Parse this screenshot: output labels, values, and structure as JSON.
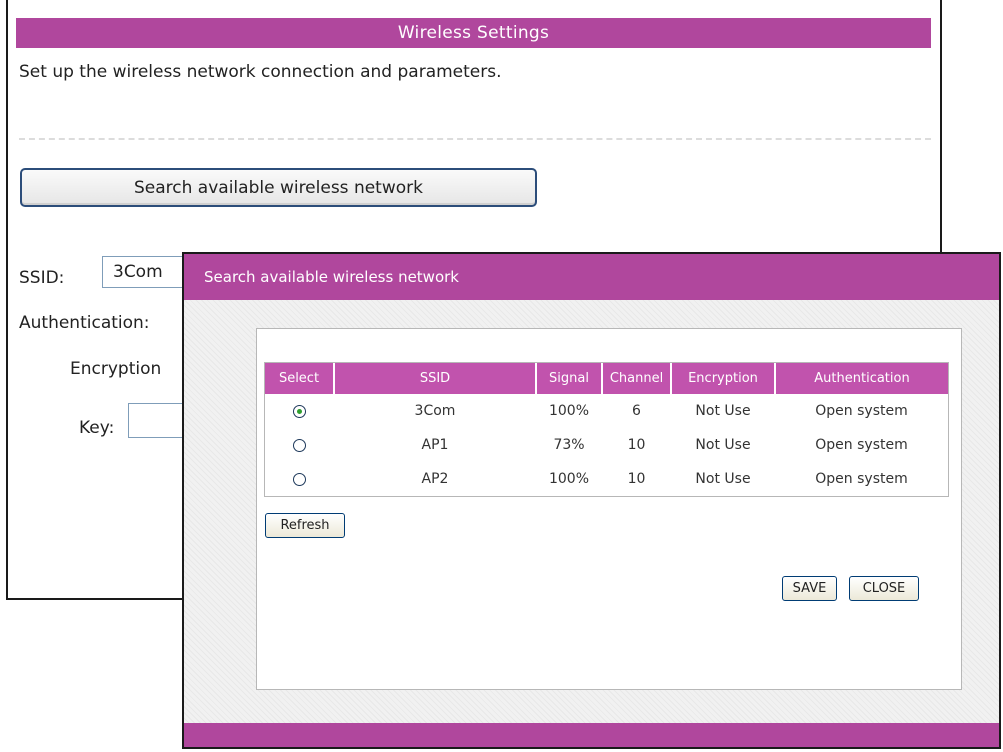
{
  "settings": {
    "header": "Wireless Settings",
    "description": "Set up the wireless network connection and parameters.",
    "search_button": "Search available wireless network",
    "ssid_label": "SSID:",
    "ssid_value": "3Com",
    "authentication_label": "Authentication:",
    "encryption_label": "Encryption",
    "key_label": "Key:"
  },
  "dialog": {
    "title": "Search available wireless network",
    "columns": [
      "Select",
      "SSID",
      "Signal",
      "Channel",
      "Encryption",
      "Authentication"
    ],
    "rows": [
      {
        "selected": true,
        "ssid": "3Com",
        "signal": "100%",
        "channel": "6",
        "encryption": "Not Use",
        "authentication": "Open system"
      },
      {
        "selected": false,
        "ssid": "AP1",
        "signal": "73%",
        "channel": "10",
        "encryption": "Not Use",
        "authentication": "Open system"
      },
      {
        "selected": false,
        "ssid": "AP2",
        "signal": "100%",
        "channel": "10",
        "encryption": "Not Use",
        "authentication": "Open system"
      }
    ],
    "refresh_button": "Refresh",
    "save_button": "SAVE",
    "close_button": "CLOSE"
  },
  "colors": {
    "accent": "#b0479d",
    "table_header": "#c153ad",
    "button_border": "#2c4d7a"
  }
}
